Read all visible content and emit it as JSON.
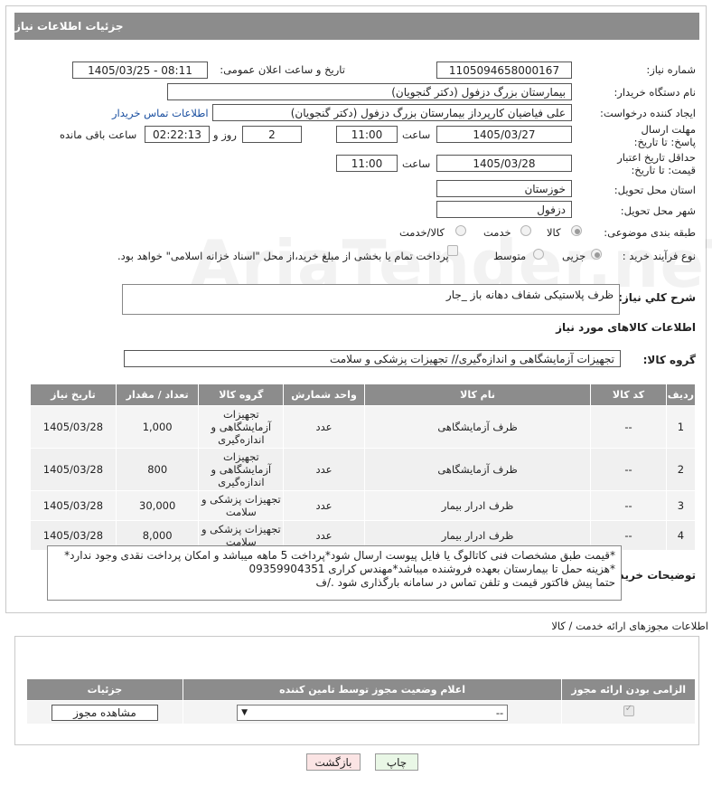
{
  "header": {
    "title": "جزئیات اطلاعات نیاز"
  },
  "watermark": {
    "text": "AriaTender.neT"
  },
  "labels": {
    "need_number": "شماره نیاز:",
    "announce_datetime": "تاریخ و ساعت اعلان عمومی:",
    "buyer_org": "نام دستگاه خریدار:",
    "requester": "ایجاد کننده درخواست:",
    "contact_link": "اطلاعات تماس خریدار",
    "reply_deadline": "مهلت ارسال پاسخ: تا تاریخ:",
    "time": "ساعت",
    "day_and": "روز و",
    "remaining": "ساعت باقی مانده",
    "price_validity": "حداقل تاریخ اعتبار قیمت: تا تاریخ:",
    "delivery_province": "استان محل تحویل:",
    "delivery_city": "شهر محل تحویل:",
    "category": "طبقه بندی موضوعی:",
    "process_type": "نوع فرآیند خرید :",
    "general_description": "شرح کلي نياز:",
    "goods_info": "اطلاعات کالاهای مورد نیاز",
    "goods_group": "گروه کالا:",
    "buyer_notes": "توضیحات خریدار:",
    "permits_title": "اطلاعات مجوزهای ارائه خدمت / کالا"
  },
  "values": {
    "need_number": "1105094658000167",
    "announce_datetime": "1405/03/25 - 08:11",
    "buyer_org": "بیمارستان بزرگ دزفول (دکتر گنجویان)",
    "requester": "علی فیاضیان کارپرداز بیمارستان بزرگ دزفول (دکتر گنجویان)",
    "reply_date": "1405/03/27",
    "reply_time": "11:00",
    "reply_days": "2",
    "reply_remaining": "02:22:13",
    "validity_date": "1405/03/28",
    "validity_time": "11:00",
    "province": "خوزستان",
    "city": "دزفول",
    "general_description": "ظرف پلاستیکی شفاف دهانه باز _جار",
    "goods_group": "تجهیزات آزمایشگاهی و اندازه‌گیری// تجهیزات پزشکی و سلامت"
  },
  "category_options": {
    "goods": "کالا",
    "service": "خدمت",
    "goods_service": "کالا/خدمت",
    "selected": "goods"
  },
  "process_options": {
    "partial": "جزیی",
    "medium": "متوسط",
    "payment_note": "پرداخت تمام یا بخشی از مبلغ خرید،از محل \"اسناد خزانه اسلامی\" خواهد بود.",
    "selected": "partial"
  },
  "table": {
    "headers": [
      "ردیف",
      "کد کالا",
      "نام کالا",
      "واحد شمارش",
      "گروه کالا",
      "تعداد / مقدار",
      "تاریخ نیاز"
    ],
    "rows": [
      [
        "1",
        "--",
        "ظرف آزمایشگاهی",
        "عدد",
        "تجهیزات آزمایشگاهی و اندازه‌گیری",
        "1,000",
        "1405/03/28"
      ],
      [
        "2",
        "--",
        "ظرف آزمایشگاهی",
        "عدد",
        "تجهیزات آزمایشگاهی و اندازه‌گیری",
        "800",
        "1405/03/28"
      ],
      [
        "3",
        "--",
        "ظرف ادرار بیمار",
        "عدد",
        "تجهیزات پزشکی و سلامت",
        "30,000",
        "1405/03/28"
      ],
      [
        "4",
        "--",
        "ظرف ادرار بیمار",
        "عدد",
        "تجهیزات پزشکی و سلامت",
        "8,000",
        "1405/03/28"
      ]
    ]
  },
  "notes": {
    "line1": "*قیمت طبق مشخصات فنی کاتالوگ یا فایل پیوست ارسال شود*پرداخت 5 ماهه میباشد و امکان پرداخت نقدی وجود ندارد*",
    "line2": "*هزینه حمل تا بیمارستان بعهده فروشنده میباشد*مهندس کراری 09359904351",
    "line3": "حتما پیش فاکتور قیمت و تلفن تماس در سامانه بارگذاری شود ./ف"
  },
  "permits": {
    "headers": [
      "الزامی بودن ارائه مجوز",
      "اعلام وضعیت مجوز توسط تامین کننده",
      "جزئیات"
    ],
    "select_value": "--",
    "view_button": "مشاهده مجوز"
  },
  "buttons": {
    "print": "چاپ",
    "back": "بازگشت"
  },
  "colors": {
    "header_bg": "#8c8c8c",
    "back_button_bg": "#fbe4e4",
    "print_button_bg": "#e9f7e6"
  }
}
